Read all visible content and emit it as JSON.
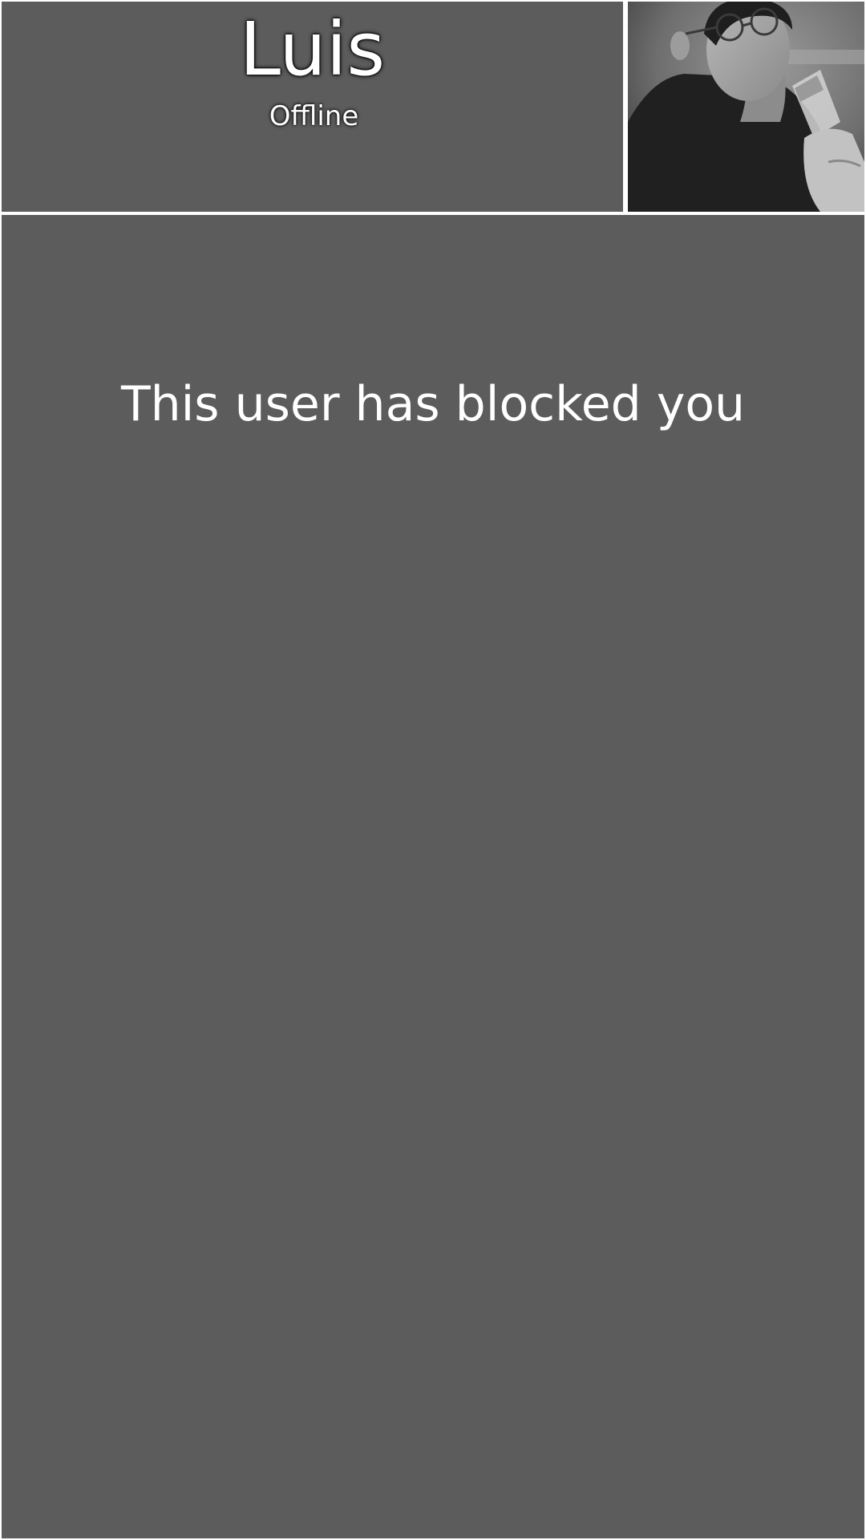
{
  "header": {
    "contact_name": "Luis",
    "status": "Offline"
  },
  "avatar": {
    "icon": "profile-photo"
  },
  "main": {
    "blocked_message": "This user has blocked you"
  },
  "colors": {
    "panel_background": "#5c5c5c",
    "divider": "#ffffff",
    "text": "#ffffff"
  }
}
